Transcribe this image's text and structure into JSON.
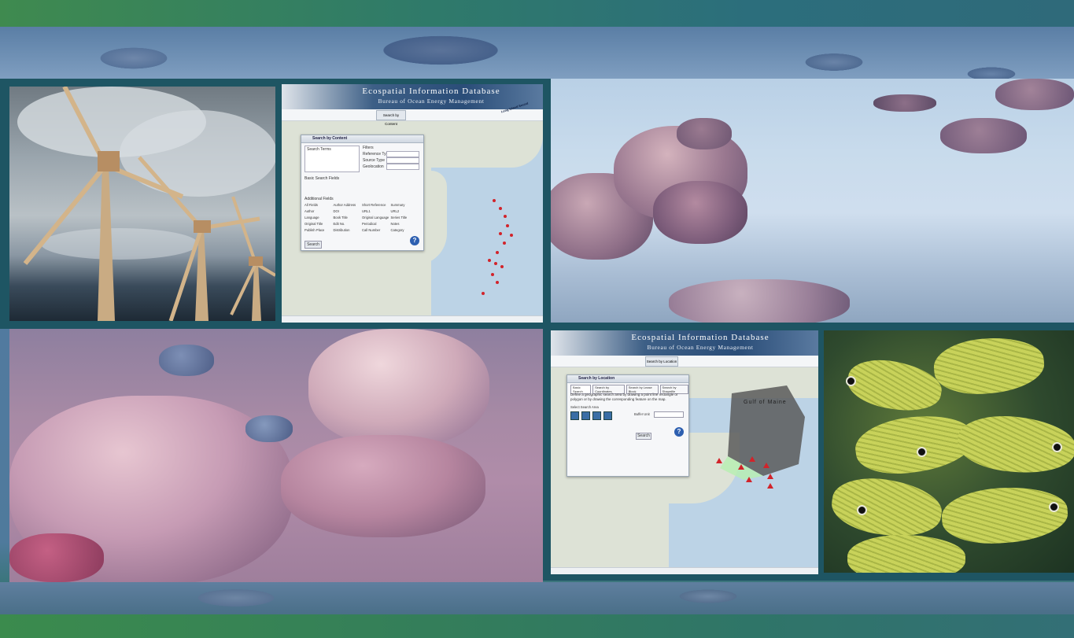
{
  "map_top": {
    "title": "Ecospatial Information Database",
    "subtitle": "Bureau of Ocean Energy Management",
    "center_button": "Search by Content",
    "dialog_title": "Search by Content",
    "search_button": "Search",
    "section_labels": [
      "Search Terms",
      "Filters",
      "Basic Search Fields",
      "Additional Fields"
    ],
    "field_labels": [
      "Reference Type",
      "Source Type",
      "Geolocation"
    ],
    "checkbox_labels": [
      "All Fields",
      "Author",
      "Language",
      "Original Title",
      "Publish Place",
      "Author Address",
      "DOI",
      "Book Title",
      "Edit No.",
      "Distribution",
      "Short Reference",
      "URL1",
      "Original Language",
      "Periodical",
      "Call Number",
      "Summary",
      "URL2",
      "Series Title",
      "Notes",
      "Category"
    ],
    "ocean_label": "Long Island Sound"
  },
  "map_bottom": {
    "title": "Ecospatial Information Database",
    "subtitle": "Bureau of Ocean Energy Management",
    "center_button": "Search by Location",
    "dialog_title": "Search by Location",
    "tabs": [
      "Basic Search",
      "Search by Coordinates",
      "Search by Lease Block",
      "Search by Shapefile"
    ],
    "instruction": "Define a geographic search area by drawing a point line rectangle or polygon or by drawing the corresponding feature on the map.",
    "draw_label": "Select Search Area",
    "buffer_label": "Buffer Unit",
    "search_button": "Search",
    "region_label": "Gulf of Maine"
  },
  "colors": {
    "frame": "#1e5563",
    "top_band": "#3f8a4f",
    "bottom_band": "#3b8b4d",
    "marker": "#d2232a"
  }
}
